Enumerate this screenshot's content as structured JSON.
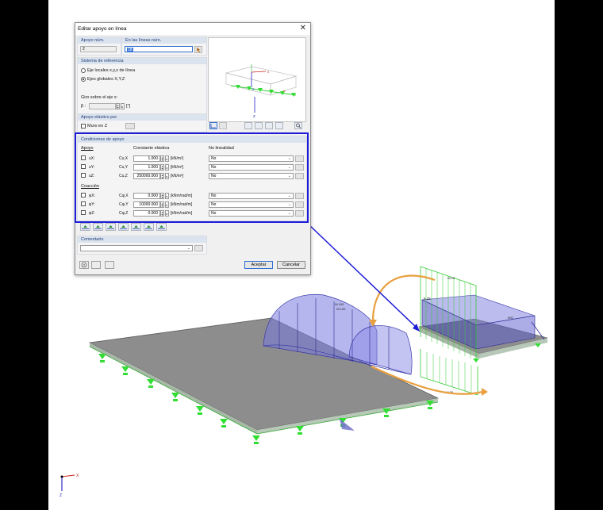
{
  "dialog": {
    "title": "Editar apoyo en línea",
    "close_symbol": "✕",
    "support_no": {
      "header": "Apoyo núm.",
      "value": "2"
    },
    "lines_no": {
      "header": "En las líneas núm.",
      "value": "18"
    },
    "ref_system": {
      "header": "Sistema de referencia",
      "option_local": "Eje locales x,y,z  de línea",
      "option_global": "Ejes globales X,Y,Z",
      "rotation_label": "Giro sobre el eje x:",
      "beta_label": "β :",
      "beta_unit": "[°]"
    },
    "elastic": {
      "header": "Apoyo elástico por",
      "wall_label": "Muro en Z"
    },
    "conditions": {
      "header": "Condiciones de apoyo",
      "apoyo_label": "Apoyo",
      "constante_label": "Constante elástica",
      "nonlin_label": "No linealidad",
      "coaccion_label": "Coacción",
      "rows": [
        {
          "dof": "uX:",
          "const": "Cu,X",
          "value": "1.000",
          "unit": "[kN/m²]",
          "nonlin": "No"
        },
        {
          "dof": "uY:",
          "const": "Cu,Y",
          "value": "1.000",
          "unit": "[kN/m²]",
          "nonlin": "No"
        },
        {
          "dof": "uZ:",
          "const": "Cu,Z",
          "value": "250000.000",
          "unit": "[kN/m²]",
          "nonlin": "No"
        },
        {
          "dof": "φX:",
          "const": "Cφ,X",
          "value": "0.000",
          "unit": "[kNm/rad/m]",
          "nonlin": "No"
        },
        {
          "dof": "φY:",
          "const": "Cφ,Y",
          "value": "10000.000",
          "unit": "[kNm/rad/m]",
          "nonlin": "No"
        },
        {
          "dof": "φZ:",
          "const": "Cφ,Z",
          "value": "0.000",
          "unit": "[kNm/rad/m]",
          "nonlin": "No"
        }
      ]
    },
    "comment": {
      "header": "Comentario",
      "value": ""
    },
    "buttons": {
      "ok": "Aceptar",
      "cancel": "Cancelar"
    }
  },
  "preview_axes": {
    "x": "x",
    "z": "z",
    "X": "X",
    "Z": "Z"
  },
  "scene_labels": {
    "arc_top": "W.100",
    "arc_sub": "W.100",
    "wall_top": "W.25",
    "wall_left": "6.25",
    "wall_right": "500",
    "strip_bottom": "W.25"
  },
  "corner_axes": {
    "x": "X",
    "z": "Z"
  },
  "colors": {
    "highlight": "#1c1cd6",
    "arrow_orange": "#e8a040",
    "support_green": "#33dd33",
    "load_blue": "#6e6ed8"
  }
}
